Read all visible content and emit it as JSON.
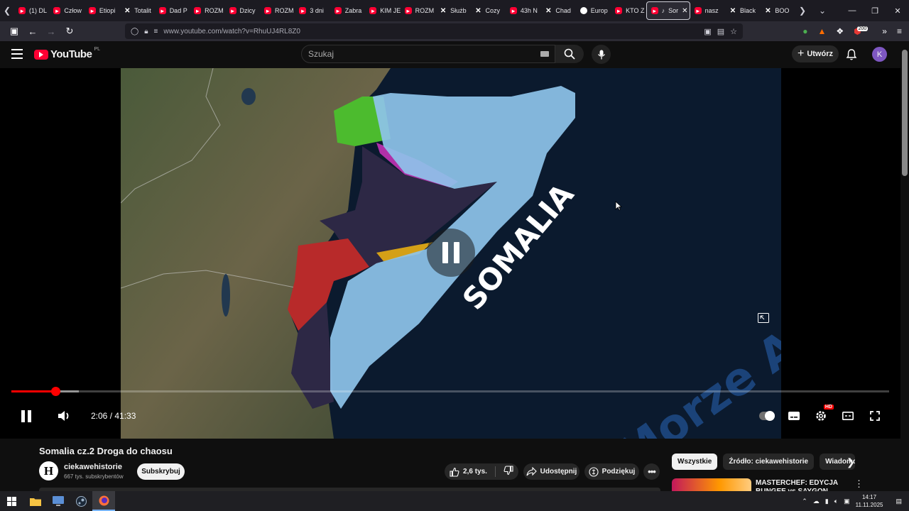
{
  "browser": {
    "tabs": [
      {
        "label": "(1) DL",
        "icon": "yt"
      },
      {
        "label": "Człow",
        "icon": "yt"
      },
      {
        "label": "Etiopi",
        "icon": "yt"
      },
      {
        "label": "Totalit",
        "icon": "x"
      },
      {
        "label": "Dad P",
        "icon": "yt"
      },
      {
        "label": "ROZM",
        "icon": "yt"
      },
      {
        "label": "Dzicy",
        "icon": "yt"
      },
      {
        "label": "ROZM",
        "icon": "yt"
      },
      {
        "label": "3 dni",
        "icon": "yt"
      },
      {
        "label": "Zabra",
        "icon": "yt"
      },
      {
        "label": "KIM JE",
        "icon": "yt"
      },
      {
        "label": "ROZM",
        "icon": "yt"
      },
      {
        "label": "Służb",
        "icon": "x"
      },
      {
        "label": "Cozy",
        "icon": "x"
      },
      {
        "label": "43h N",
        "icon": "yt"
      },
      {
        "label": "Chad",
        "icon": "x"
      },
      {
        "label": "Europ",
        "icon": "eu"
      },
      {
        "label": "KTO Z",
        "icon": "yt"
      },
      {
        "label": "Sor",
        "icon": "yt",
        "active": true
      },
      {
        "label": "nasz",
        "icon": "yt"
      },
      {
        "label": "Black",
        "icon": "x"
      },
      {
        "label": "BOO",
        "icon": "x"
      }
    ],
    "url": "www.youtube.com/watch?v=RhuUJ4RL8Z0",
    "extension_badge": "200"
  },
  "youtube": {
    "logo_text": "YouTube",
    "logo_region": "PL",
    "search_placeholder": "Szukaj",
    "create_label": "Utwórz",
    "avatar_letter": "K"
  },
  "player": {
    "time_current": "2:06",
    "time_total": "41:33",
    "time_display": "2:06 / 41:33",
    "progress_fraction": 0.0505,
    "buffered_fraction": 0.077,
    "hd_badge": "HD",
    "map_label": "SOMALIA",
    "sea_label": "Morze A"
  },
  "video": {
    "title": "Somalia cz.2 Droga do chaosu",
    "channel_name": "ciekawehistorie",
    "channel_logo_letter": "H",
    "channel_subs": "667 tys. subskrybentów",
    "subscribe_label": "Subskrybuj",
    "like_count": "2,6 tys.",
    "share_label": "Udostępnij",
    "thanks_label": "Podziękuj"
  },
  "sidebar": {
    "chips": [
      "Wszystkie",
      "Źródło: ciekawehistorie",
      "Wiadomo"
    ],
    "rec_title": "MASTERCHEF: EDYCJA BUNGEE vs SAYGON"
  },
  "taskbar": {
    "time": "14:17",
    "date": "11.11.2025"
  },
  "colors": {
    "accent_red": "#ff0000",
    "somalia_blue": "#8ec3ea",
    "ocean": "#0b1a2e"
  }
}
